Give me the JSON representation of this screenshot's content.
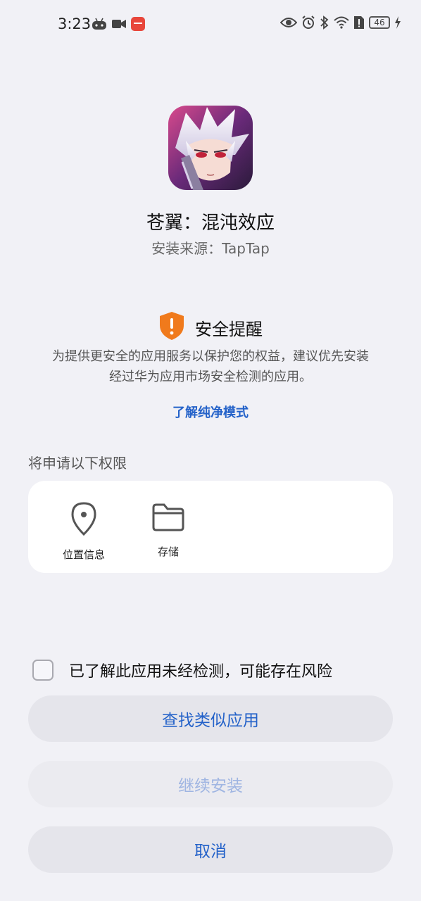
{
  "status_bar": {
    "time": "3:23",
    "battery_level": "46",
    "left_icons": [
      "android-game-icon",
      "video-camera-icon",
      "app-notification-icon"
    ],
    "right_icons": [
      "eye-icon",
      "alarm-icon",
      "bluetooth-icon",
      "wifi-icon",
      "sim-alert-icon",
      "battery-icon",
      "charging-icon"
    ]
  },
  "app": {
    "name": "苍翼：混沌效应",
    "source": "安装来源：TapTap"
  },
  "security": {
    "title": "安全提醒",
    "description_line1": "为提供更安全的应用服务以保护您的权益，建议优先安装",
    "description_line2": "经过华为应用市场安全检测的应用。",
    "learn_more": "了解纯净模式",
    "icon_color": "#f07a1c"
  },
  "permissions": {
    "label": "将申请以下权限",
    "items": [
      {
        "label": "位置信息",
        "icon": "location-pin-icon"
      },
      {
        "label": "存储",
        "icon": "folder-icon"
      }
    ]
  },
  "risk_checkbox": {
    "label": "已了解此应用未经检测，可能存在风险",
    "checked": false
  },
  "buttons": {
    "find_similar": "查找类似应用",
    "continue_install": "继续安装",
    "cancel": "取消"
  },
  "colors": {
    "accent": "#2462c9",
    "background": "#f1f1f6"
  }
}
